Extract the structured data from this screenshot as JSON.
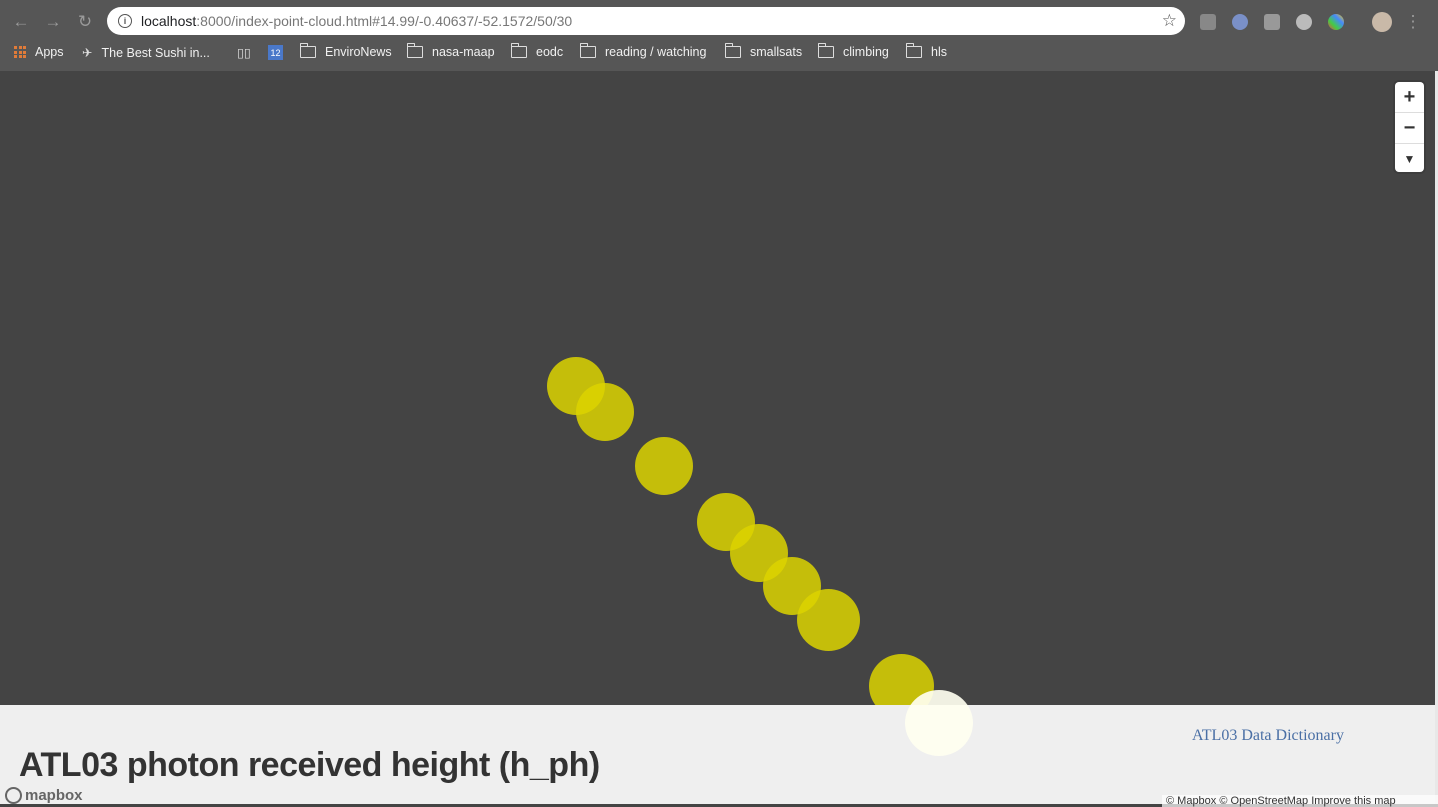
{
  "browser": {
    "url_host": "localhost",
    "url_rest": ":8000/index-point-cloud.html#14.99/-0.40637/-52.1572/50/30",
    "bookmarks": [
      {
        "label": "Apps",
        "icon": "apps-grid-icon"
      },
      {
        "label": "The Best Sushi in...",
        "icon": "site-icon"
      },
      {
        "label": "",
        "icon": "book-icon"
      },
      {
        "label": "",
        "icon": "calendar-icon"
      },
      {
        "label": "EnviroNews",
        "icon": "folder-icon"
      },
      {
        "label": "nasa-maap",
        "icon": "folder-icon"
      },
      {
        "label": "eodc",
        "icon": "folder-icon"
      },
      {
        "label": "reading / watching",
        "icon": "folder-icon"
      },
      {
        "label": "smallsats",
        "icon": "folder-icon"
      },
      {
        "label": "climbing",
        "icon": "folder-icon"
      },
      {
        "label": "hls",
        "icon": "folder-icon"
      }
    ],
    "calendar_day": "12"
  },
  "map": {
    "point_color": "#dcd400",
    "controls": {
      "zoom_in": "+",
      "zoom_out": "−",
      "compass": "▼"
    }
  },
  "panel": {
    "title": "ATL03 photon received height (h_ph)",
    "link": "ATL03 Data Dictionary"
  },
  "footer": {
    "logo": "mapbox",
    "attribution": "© Mapbox © OpenStreetMap Improve this map"
  }
}
